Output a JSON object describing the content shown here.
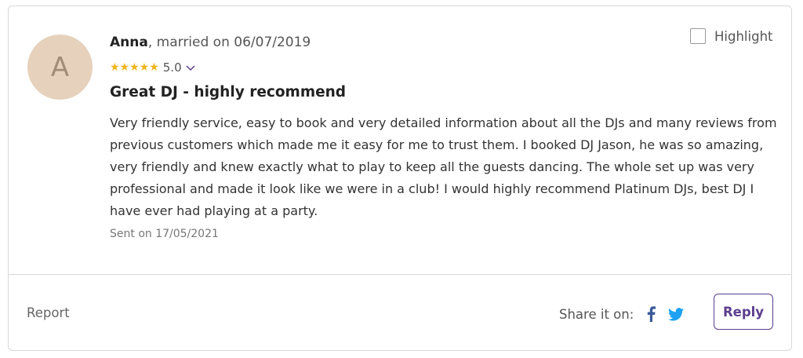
{
  "review": {
    "avatar_initial": "A",
    "author": "Anna",
    "married_text": ", married on 06/07/2019",
    "stars": "★★★★★",
    "rating": "5.0",
    "title": "Great DJ - highly recommend",
    "body": "Very friendly service, easy to book and very detailed information about all the DJs and many reviews from previous customers which made me it easy for me to trust them. I booked DJ Jason, he was so amazing, very friendly and knew exactly what to play to keep all the guests dancing. The whole set up was very professional and made it look like we were in a club! I would highly recommend Platinum DJs, best DJ I have ever had playing at a party.",
    "sent": "Sent on 17/05/2021"
  },
  "highlight": {
    "label": "Highlight",
    "checked": false
  },
  "footer": {
    "report_label": "Report",
    "share_label": "Share it on:",
    "reply_label": "Reply"
  },
  "icons": {
    "facebook": "facebook-icon",
    "twitter": "twitter-icon",
    "chevron": "chevron-down-icon"
  },
  "colors": {
    "star": "#f0b41c",
    "accent": "#5c3f8f",
    "facebook": "#3b5998",
    "twitter": "#1da1f2",
    "avatar_bg": "#e6d2bc"
  }
}
